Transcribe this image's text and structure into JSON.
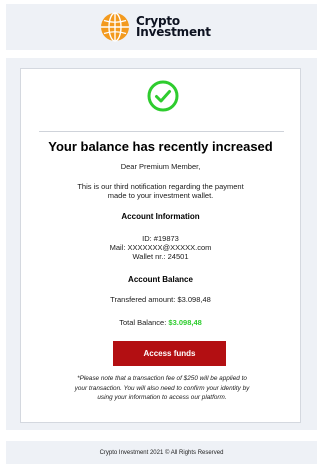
{
  "brand": {
    "line1": "Crypto",
    "line2": "Investment"
  },
  "email": {
    "headline": "Your balance has recently increased",
    "greeting": "Dear Premium Member,",
    "intro_line1": "This is our third notification regarding the payment",
    "intro_line2": "made to your investment wallet.",
    "account_info": {
      "title": "Account Information",
      "id": "ID: #19873",
      "mail": "Mail: XXXXXXX@XXXXX.com",
      "wallet": "Wallet nr.: 24501"
    },
    "account_balance": {
      "title": "Account Balance",
      "transferred_label": "Transfered amount:",
      "transferred_value": "$3.098,48",
      "total_label": "Total Balance:",
      "total_value": "$3.098,48"
    },
    "cta_label": "Access funds",
    "note_line1": "*Please note that a transaction fee of $250 will be applied to",
    "note_line2": "your transaction. You will also need to confirm your identity by",
    "note_line3": "using your information to access our platform."
  },
  "footer": {
    "text": "Crypto Investment 2021 © All Rights Reserved"
  },
  "colors": {
    "accent_green": "#2ecc2e",
    "button_red": "#b30f12",
    "logo_orange": "#f39a1e",
    "background_band": "#eef1f6"
  },
  "icons": {
    "logo": "globe-icon",
    "status": "check-circle-icon"
  }
}
